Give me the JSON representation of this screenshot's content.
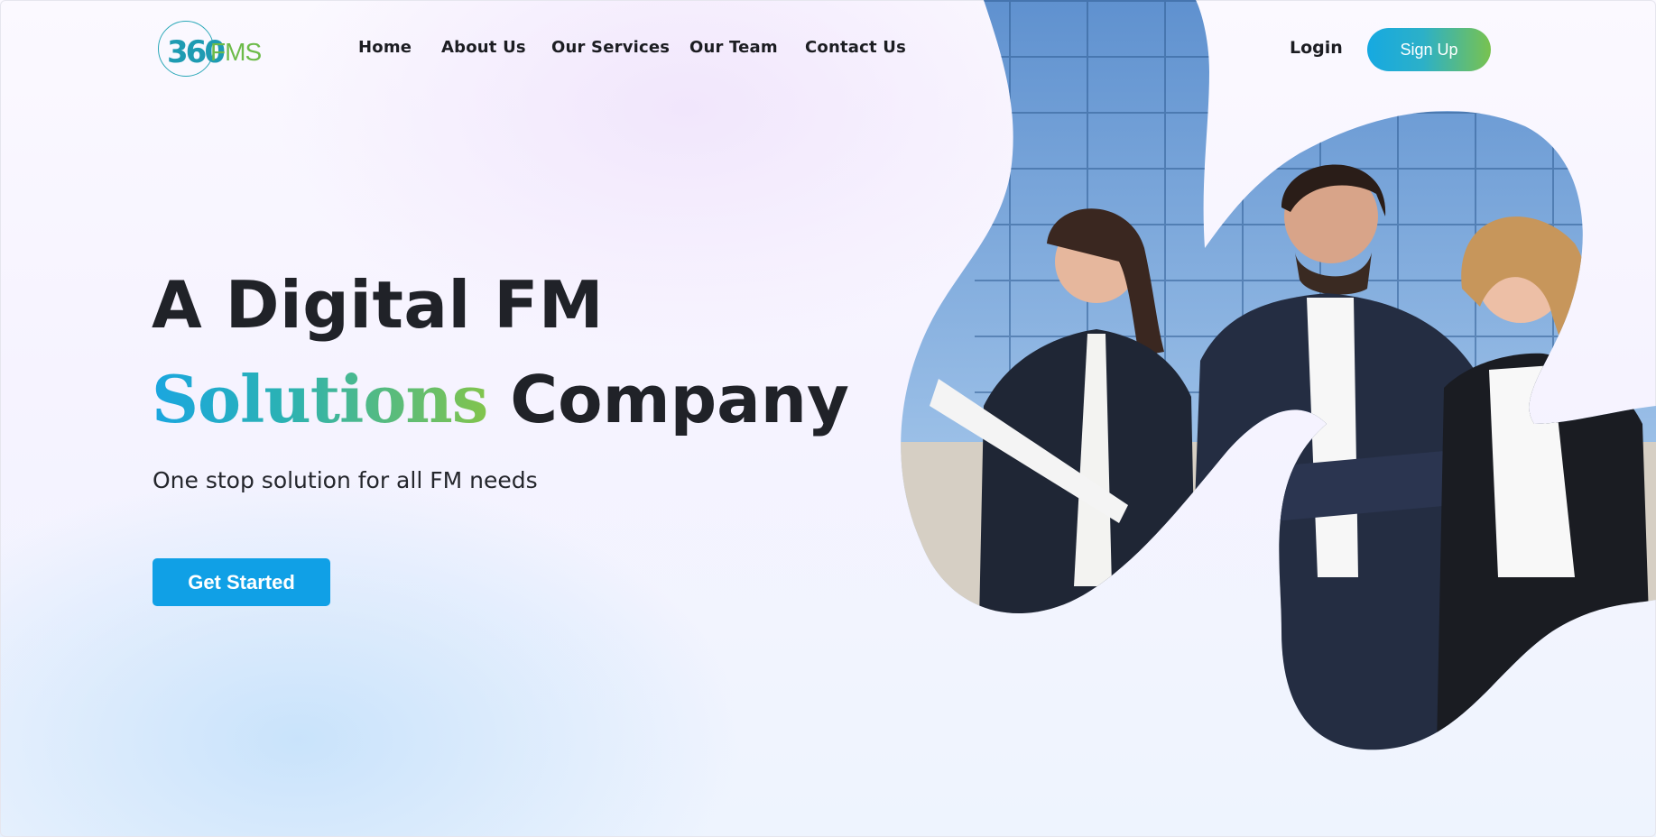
{
  "header": {
    "logo": {
      "mark": "360",
      "brand_prefix": "F",
      "brand_mid": "M",
      "brand_suffix": "S"
    },
    "nav": [
      {
        "label": "Home"
      },
      {
        "label": "About Us"
      },
      {
        "label": "Our Services"
      },
      {
        "label": "Our Team"
      },
      {
        "label": "Contact Us"
      }
    ],
    "login_label": "Login",
    "signup_label": "Sign Up"
  },
  "hero": {
    "title_line1": "A Digital FM",
    "title_accent": "Solutions",
    "title_line2_rest": " Company",
    "subtitle": "One stop solution for all FM needs",
    "cta_label": "Get Started",
    "image": "business-team-photo"
  },
  "colors": {
    "brand_blue": "#10a0e6",
    "brand_teal": "#2bb2b3",
    "brand_green": "#82c44c",
    "text_dark": "#202228"
  }
}
